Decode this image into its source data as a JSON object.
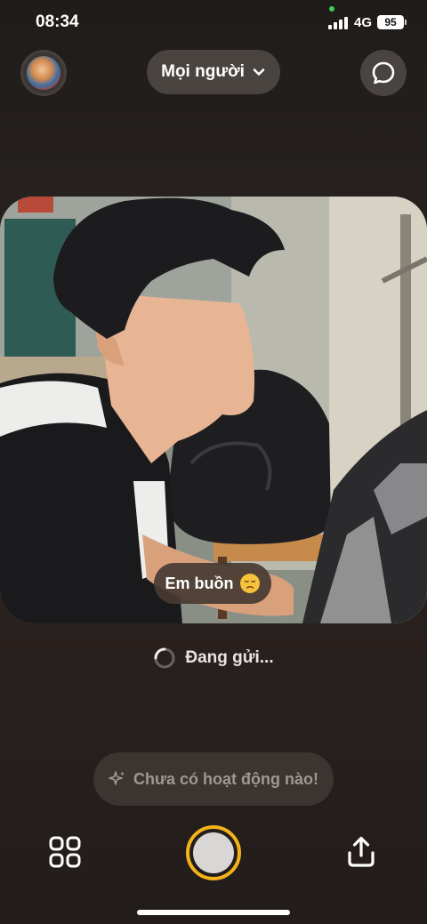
{
  "status_bar": {
    "time": "08:34",
    "network": "4G",
    "battery": "95"
  },
  "header": {
    "audience_label": "Mọi người",
    "icons": [
      "avatar",
      "chevron-down-icon",
      "chat-bubble-icon"
    ]
  },
  "photo": {
    "caption_text": "Em buồn",
    "caption_emoji": "sad-face-emoji"
  },
  "sending": {
    "label": "Đang gửi..."
  },
  "activity": {
    "label": "Chưa có hoạt động nào!",
    "icon": "sparkle-icon"
  },
  "bottom_bar": {
    "icons": [
      "grid-icon",
      "shutter-button",
      "share-icon"
    ]
  },
  "colors": {
    "background": "#2a2320",
    "pill": "#4a4440",
    "shutter_ring": "#f2b31b",
    "status_dot": "#3ad15c"
  }
}
